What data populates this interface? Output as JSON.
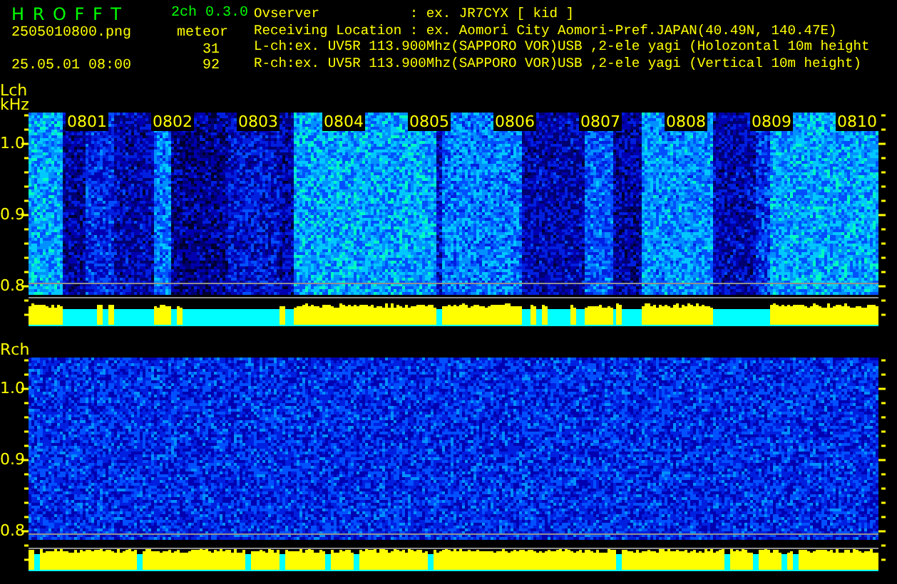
{
  "header": {
    "app_title": "H R O F F T",
    "version": "2ch 0.3.0",
    "filename": "2505010800.png",
    "timestamp": "25.05.01 08:00",
    "meteor_label": "meteor",
    "counts": [
      "31",
      "92"
    ]
  },
  "info_lines": [
    "Ovserver           : ex. JR7CYX [ kid ]",
    "Receiving Location : ex. Aomori City Aomori-Pref.JAPAN(40.49N, 140.47E)",
    "L-ch:ex. UV5R 113.900Mhz(SAPPORO VOR)USB ,2-ele yagi (Holozontal 10m height",
    "R-ch:ex. UV5R 113.900Mhz(SAPPORO VOR)USB ,2-ele yagi (Vertical 10m height)"
  ],
  "channels": [
    {
      "label": "Lch",
      "unit": "kHz",
      "kind": "banded",
      "yticks": [
        "1.0",
        "0.9",
        "0.8"
      ],
      "time_labels": [
        "0801",
        "0802",
        "0803",
        "0804",
        "0805",
        "0806",
        "0807",
        "0808",
        "0809",
        "0810"
      ]
    },
    {
      "label": "Rch",
      "kind": "uniform",
      "yticks": [
        "1.0",
        "0.9",
        "0.8"
      ]
    }
  ]
}
